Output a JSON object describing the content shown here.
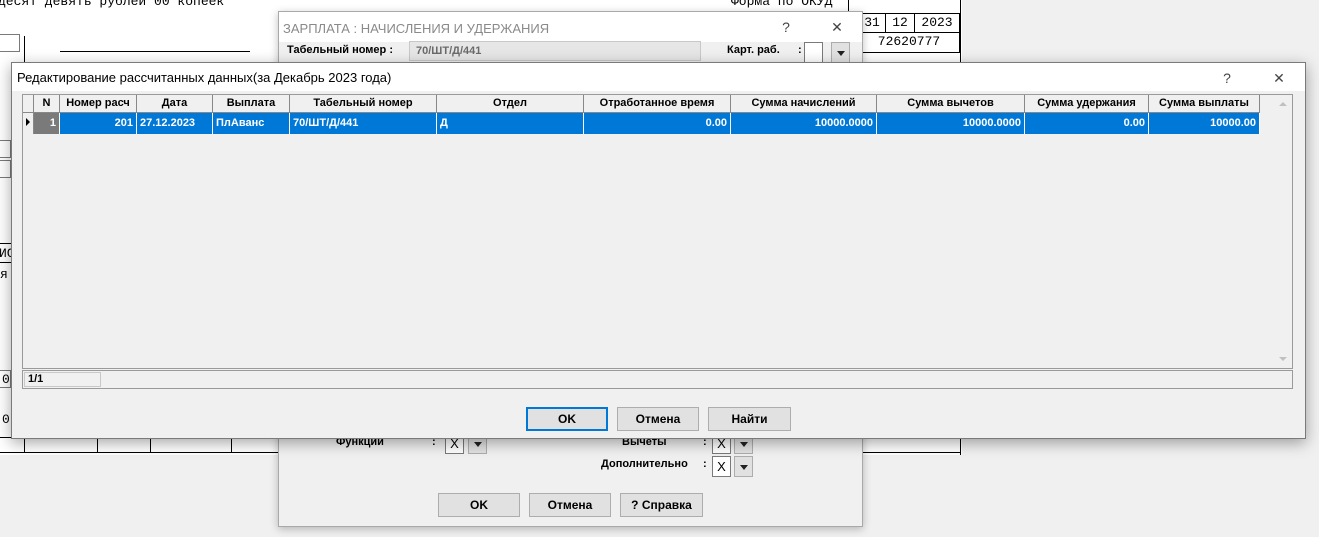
{
  "background_document": {
    "amount_text": "десят девять рублей 00 копеек",
    "okud_label": "Форма по ОКУД",
    "date_cells": [
      "31",
      "12",
      "2023"
    ],
    "code": "72620777",
    "left_fragment_1": "ИС",
    "left_fragment_2": "я",
    "left_fragment_3": "0",
    "left_fragment_4": "0"
  },
  "mid_dialog": {
    "title": "ЗАРПЛАТА : НАЧИСЛЕНИЯ И УДЕРЖАНИЯ",
    "help_glyph": "?",
    "close_glyph": "✕",
    "tab_number_label": "Табельный номер :",
    "tab_number_value": "70/ШТ/Д/441",
    "card_label": "Карт. раб.",
    "card_colon": ":",
    "functions_label": "Функции",
    "functions_colon": ":",
    "functions_value": "X",
    "deductions_label": "Вычеты",
    "deductions_colon": ":",
    "deductions_value": "X",
    "additional_label": "Дополнительно",
    "additional_colon": ":",
    "additional_value": "X",
    "ok_label": "OK",
    "cancel_label": "Отмена",
    "help_label": "? Справка"
  },
  "front_dialog": {
    "title": "Редактирование рассчитанных данных(за Декабрь 2023 года)",
    "help_glyph": "?",
    "close_glyph": "✕",
    "columns": [
      "N",
      "Номер расч",
      "Дата",
      "Выплата",
      "Табельный номер",
      "Отдел",
      "Отработанное время",
      "Сумма начислений",
      "Сумма вычетов",
      "Сумма удержания",
      "Сумма выплаты"
    ],
    "rows": [
      {
        "n": "1",
        "calc_no": "201",
        "date": "27.12.2023",
        "payment": "ПлАванс",
        "tab_number": "70/ШТ/Д/441",
        "department": "Д",
        "worked_time": "0.00",
        "accruals": "10000.0000",
        "deductions": "10000.0000",
        "withholdings": "0.00",
        "payout": "10000.00"
      }
    ],
    "record_counter": "1/1",
    "ok_label": "OK",
    "cancel_label": "Отмена",
    "find_label": "Найти"
  },
  "colors": {
    "selection": "#0078d7",
    "default_button_border": "#0078d7"
  }
}
